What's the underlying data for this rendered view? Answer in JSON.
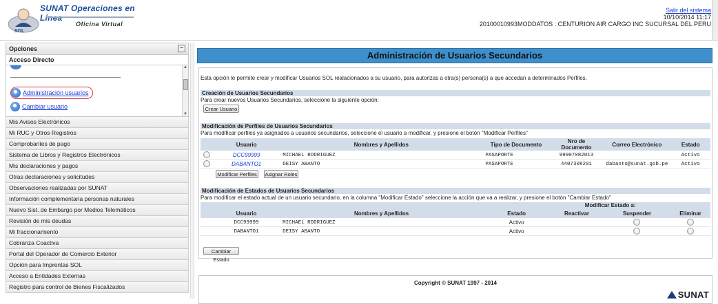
{
  "header": {
    "logo_title": "SUNAT Operaciones en Línea",
    "logo_subtitle": "Oficina Virtual",
    "logo_badge": "SOL",
    "logout_link": "Salir del sistema",
    "datetime": "10/10/2014 11:17",
    "user_info": "20100010993MODDATOS : CENTURION AIR CARGO INC SUCURSAL DEL PERU"
  },
  "sidebar": {
    "options_title": "Opciones",
    "direct_access_title": "Acceso Directo",
    "direct_access_items": [
      {
        "label": "Administración usuarios",
        "icon": "users-icon",
        "highlighted": true
      },
      {
        "label": "Cambiar usuario",
        "icon": "users-icon",
        "highlighted": false
      }
    ],
    "menu_items": [
      "Mis Avisos Electrónicos",
      "Mi RUC y Otros Registros",
      "Comprobantes de pago",
      "Sistema de Libros y Registros Electrónicos",
      "Mis declaraciones y pagos",
      "Otras declaraciones y solicitudes",
      "Observaciones realizadas por SUNAT",
      "Información complementaria personas naturales",
      "Nuevo Sist. de Embargo por Medios Telemáticos",
      "Revisión de mis deudas",
      "Mi fraccionamiento",
      "Cobranza Coactiva",
      "Portal del Operador de Comercio Exterior",
      "Opción para Imprentas SOL",
      "Acceso a Entidades Externas",
      "Registro para control de Bienes Fiscalizados"
    ]
  },
  "main": {
    "title": "Administración de Usuarios Secundarios",
    "intro": "Esta opción le permite crear y modificar Usuarios SOL realacionados a su usuario, para autorizas a otra(s) persona(s) a que accedan a determinados Perfiles.",
    "create": {
      "heading": "Creación de Usuarios Secundarios",
      "text": "Para crear nuevos Usuarios Secundarios, seleccione la siguiente opción:",
      "button": "Crear Usuario"
    },
    "profiles": {
      "heading": "Modificación de Perfiles de Usuarios Secundarios",
      "text": "Para modificar perfiles ya asignados a usuarios secundarios, seleccione el usuario a modificar, y presione el botón \"Modificar Perfiles\"",
      "columns": [
        "Usuario",
        "Nombres y Apellidos",
        "Tipo de Documento",
        "Nro de Documento",
        "Correo Electrónico",
        "Estado"
      ],
      "rows": [
        {
          "usuario": "DCC99999",
          "nombre": "MICHAEL RODRIGUEZ",
          "tipo": "PASAPORTE",
          "nro": "99907082013",
          "correo": "",
          "estado": "Activo"
        },
        {
          "usuario": "DABANTO1",
          "nombre": "DEISY ABANTO",
          "tipo": "PASAPORTE",
          "nro": "4407308201",
          "correo": "dabanto@sunat.gob.pe",
          "estado": "Activo"
        }
      ],
      "buttons": [
        "Modificar Perfiles",
        "Asignar Roles"
      ]
    },
    "states": {
      "heading": "Modificación de Estados de Usuarios Secundarios",
      "text": "Para modificar el estado actual de un usuario secundario, en la columna \"Modificar Estado\" seleccione la acción que va a realizar, y presione el botón \"Cambiar Estado\"",
      "group_header": "Modificar Estado a:",
      "columns": [
        "Usuario",
        "Nombres y Apellidos",
        "Estado",
        "Reactivar",
        "Suspender",
        "Eliminar"
      ],
      "rows": [
        {
          "usuario": "DCC99999",
          "nombre": "MICHAEL RODRIGUEZ",
          "estado": "Activo"
        },
        {
          "usuario": "DABANTO1",
          "nombre": "DEISY ABANTO",
          "estado": "Activo"
        }
      ],
      "button": "Cambiar Estado"
    },
    "footer": {
      "copyright": "Copyright © SUNAT 1997 - 2014",
      "brand": "SUNAT"
    }
  },
  "colors": {
    "title_bar": "#3f8fcc",
    "section_header": "#d3dde9",
    "link": "#1a3fcf",
    "highlight_ring": "#d9363e"
  }
}
